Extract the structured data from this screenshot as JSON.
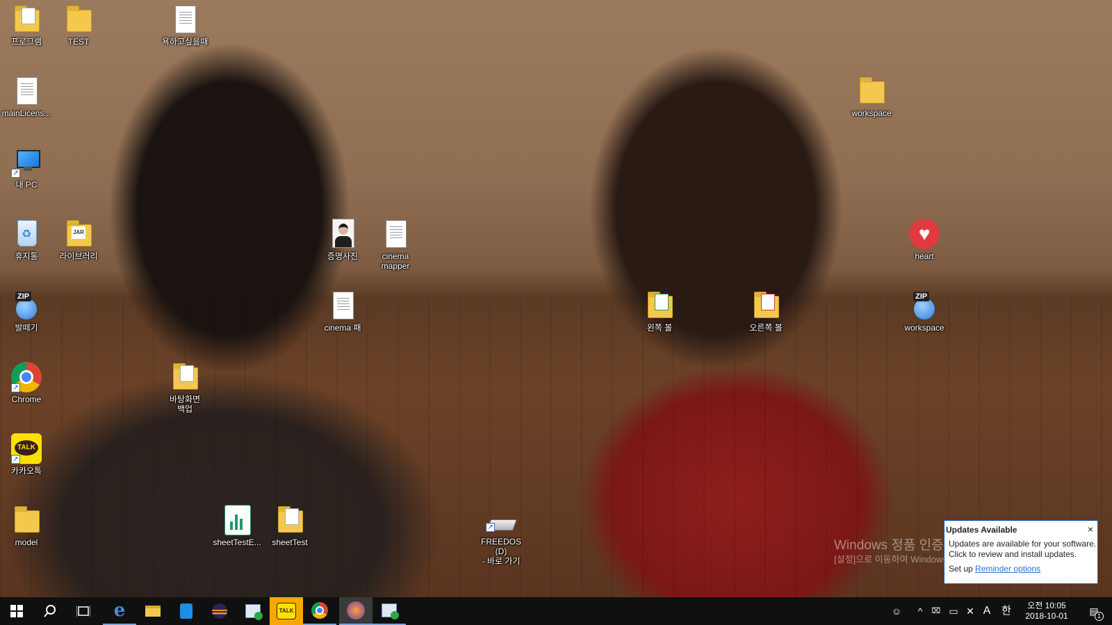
{
  "desktop": {
    "icons": [
      {
        "id": "programs",
        "label": "프로그램",
        "kind": "folder"
      },
      {
        "id": "test",
        "label": "TEST",
        "kind": "folder"
      },
      {
        "id": "yok",
        "label": "욕하고싶을때",
        "kind": "doc"
      },
      {
        "id": "mainlicense",
        "label": "mainLicens...",
        "kind": "doc"
      },
      {
        "id": "mypc",
        "label": "내 PC",
        "kind": "pc"
      },
      {
        "id": "recycle",
        "label": "휴지통",
        "kind": "recycle"
      },
      {
        "id": "library",
        "label": "라이브러리",
        "kind": "jar"
      },
      {
        "id": "idphoto",
        "label": "증명사진",
        "kind": "photo"
      },
      {
        "id": "cinemamapper",
        "label": "cinema\nmapper",
        "kind": "doc"
      },
      {
        "id": "heart",
        "label": "heart",
        "kind": "heart"
      },
      {
        "id": "workspace1",
        "label": "workspace",
        "kind": "folder"
      },
      {
        "id": "baltegi",
        "label": "발떼기",
        "kind": "zip"
      },
      {
        "id": "cinemapae",
        "label": "cinema 패",
        "kind": "doc"
      },
      {
        "id": "leftball",
        "label": "왼쪽 볼",
        "kind": "folder"
      },
      {
        "id": "rightball",
        "label": "오른쪽 볼",
        "kind": "folder"
      },
      {
        "id": "workspace2",
        "label": "workspace",
        "kind": "zip"
      },
      {
        "id": "chrome",
        "label": "Chrome",
        "kind": "chrome"
      },
      {
        "id": "wallbackup",
        "label": "바탕화면\n백업",
        "kind": "folder"
      },
      {
        "id": "kakao",
        "label": "카카오톡",
        "kind": "kakao"
      },
      {
        "id": "model",
        "label": "model",
        "kind": "folder"
      },
      {
        "id": "sheettesteq",
        "label": "sheetTestE...",
        "kind": "sheet"
      },
      {
        "id": "sheettest",
        "label": "sheetTest",
        "kind": "folder"
      },
      {
        "id": "freedos",
        "label": "FREEDOS (D)\n- 바로 가기",
        "kind": "drive"
      }
    ]
  },
  "watermark": {
    "line1": "Windows 정품 인증",
    "line2": "[설정]으로 이동하여 Windows 정품 인증"
  },
  "notification": {
    "title": "Updates Available",
    "close": "×",
    "body_line1": "Updates are available for your software.",
    "body_line2": "Click to review and install updates.",
    "setup_prefix": "Set up",
    "link": "Reminder options"
  },
  "taskbar": {
    "apps": [
      "start-icon",
      "search-icon",
      "task-view-icon",
      "edge-icon",
      "file-explorer-icon",
      "store-icon",
      "eclipse-icon",
      "media-app-icon",
      "kakaotalk-icon",
      "chrome-icon",
      "game-icon",
      "media-app2-icon"
    ],
    "tray": {
      "ime_mode": "A",
      "ime_lang": "한",
      "time": "오전 10:05",
      "date": "2018-10-01",
      "notification_count": "1"
    }
  },
  "colors": {
    "taskbar": "#101010",
    "accent": "#1f62c4",
    "link": "#2a6fd6"
  }
}
